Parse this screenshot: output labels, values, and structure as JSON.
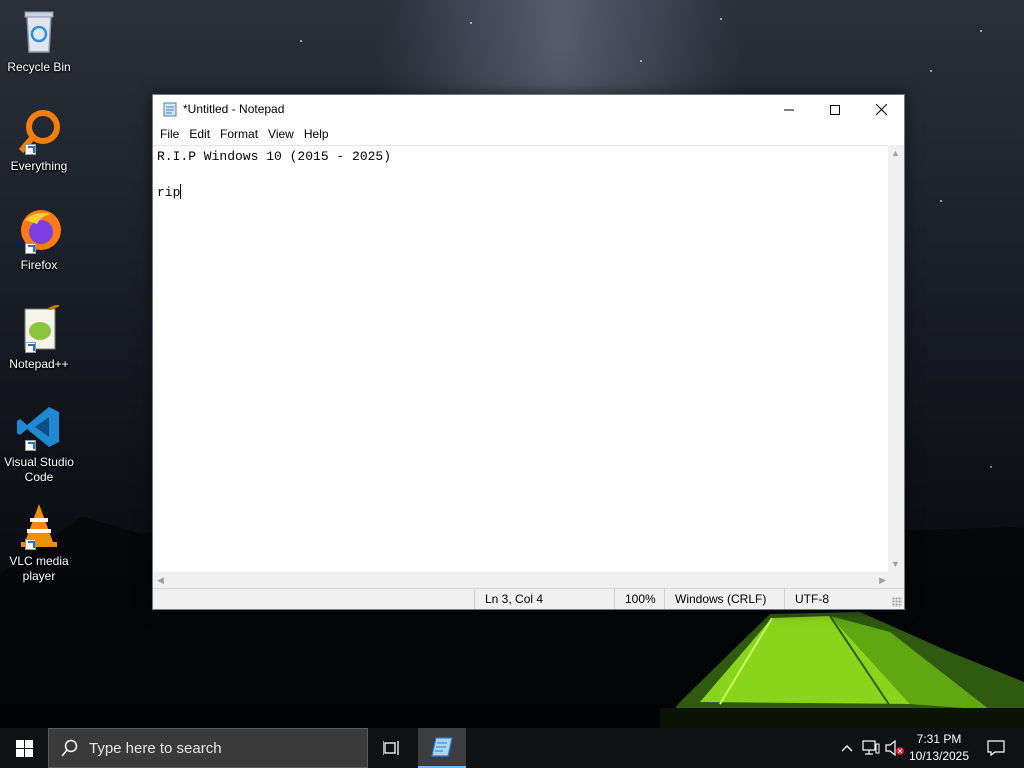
{
  "desktop": {
    "icons": [
      {
        "label": "Recycle Bin",
        "icon": "recycle-bin-icon"
      },
      {
        "label": "Everything",
        "icon": "everything-search-icon"
      },
      {
        "label": "Firefox",
        "icon": "firefox-icon"
      },
      {
        "label": "Notepad++",
        "icon": "notepad-plus-plus-icon"
      },
      {
        "label": "Visual Studio Code",
        "icon": "vscode-icon"
      },
      {
        "label": "VLC media player",
        "icon": "vlc-icon"
      }
    ]
  },
  "window": {
    "title": "*Untitled - Notepad",
    "icon": "notepad-icon",
    "controls": {
      "minimize": "minimize-icon",
      "maximize": "maximize-icon",
      "close": "close-icon"
    },
    "menu": [
      "File",
      "Edit",
      "Format",
      "View",
      "Help"
    ],
    "editor": {
      "lines": [
        "R.I.P Windows 10 (2015 - 2025)",
        "",
        "rip"
      ]
    },
    "status": {
      "position": "Ln 3, Col 4",
      "zoom": "100%",
      "line_ending": "Windows (CRLF)",
      "encoding": "UTF-8"
    }
  },
  "taskbar": {
    "start_icon": "windows-logo-icon",
    "search_placeholder": "Type here to search",
    "task_view_icon": "task-view-icon",
    "pinned_app_icon": "notepad-icon",
    "tray_icons": [
      "chevron-up-icon",
      "network-icon",
      "volume-muted-icon"
    ],
    "time": "7:31 PM",
    "date": "10/13/2025",
    "notification_icon": "action-center-icon"
  },
  "colors": {
    "accent": "#76b9ed",
    "taskbar": "#101113",
    "search_box": "#3a3a3a"
  }
}
